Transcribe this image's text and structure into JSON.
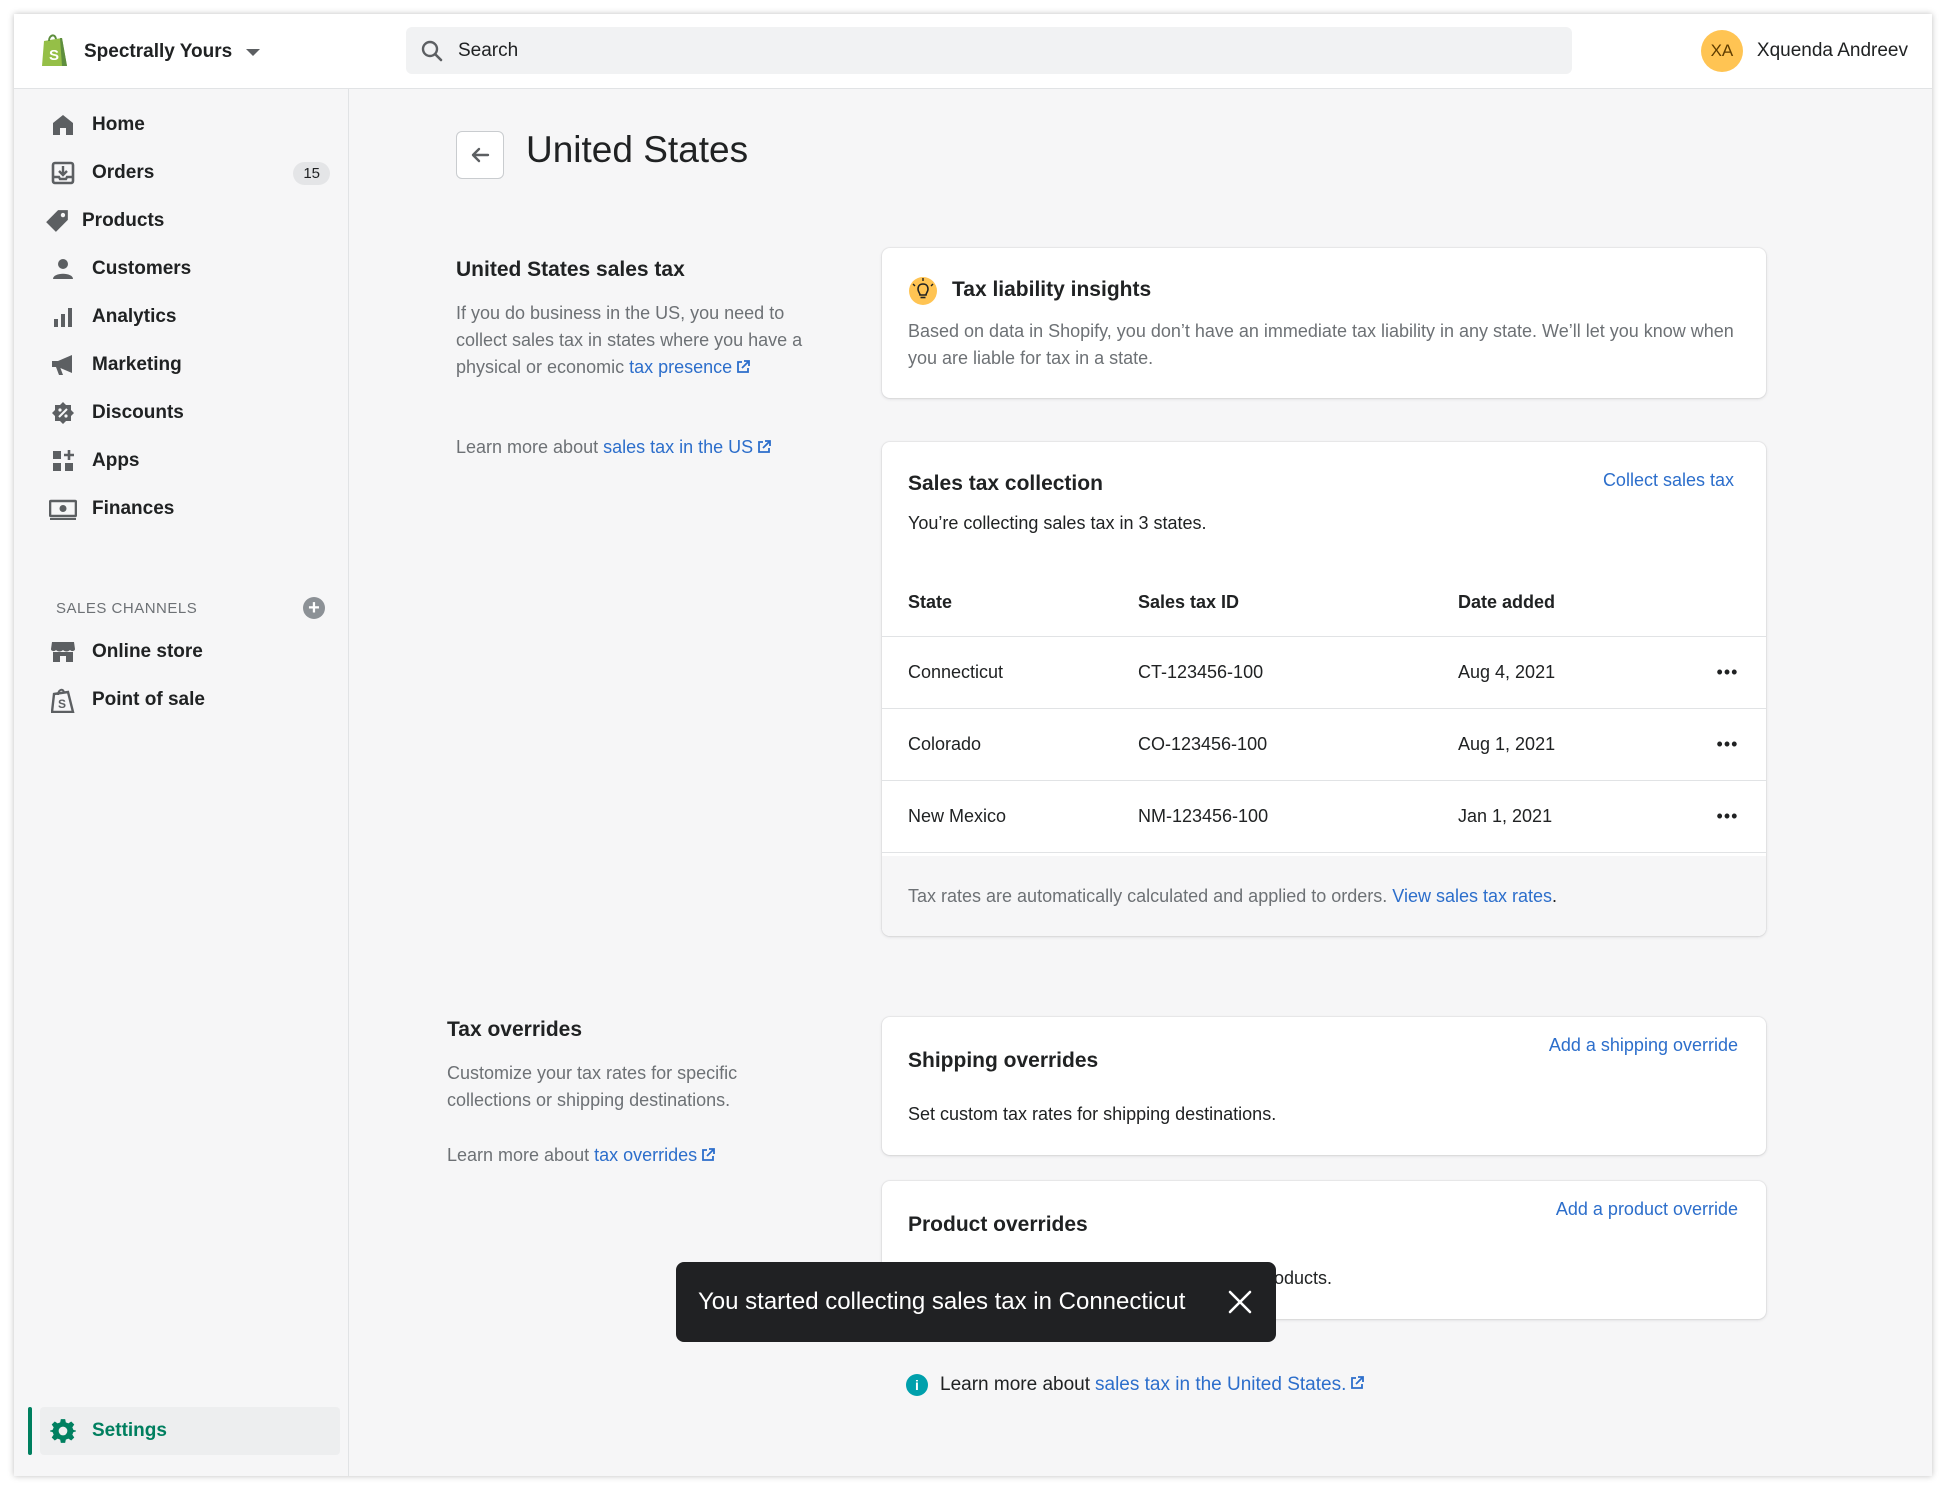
{
  "store": {
    "name": "Spectrally Yours"
  },
  "search": {
    "placeholder": "Search"
  },
  "user": {
    "initials": "XA",
    "name": "Xquenda Andreev"
  },
  "sidebar": {
    "items": [
      {
        "label": "Home"
      },
      {
        "label": "Orders",
        "badge": "15"
      },
      {
        "label": "Products"
      },
      {
        "label": "Customers"
      },
      {
        "label": "Analytics"
      },
      {
        "label": "Marketing"
      },
      {
        "label": "Discounts"
      },
      {
        "label": "Apps"
      },
      {
        "label": "Finances"
      }
    ],
    "channels_heading": "SALES CHANNELS",
    "channels": [
      {
        "label": "Online store"
      },
      {
        "label": "Point of sale"
      }
    ],
    "settings_label": "Settings"
  },
  "page": {
    "title": "United States"
  },
  "us_tax": {
    "heading": "United States sales tax",
    "desc": "If you do business in the US, you need to collect sales tax in states where you have a physical or economic ",
    "desc_link": "tax presence",
    "learn_prefix": "Learn more about ",
    "learn_link": "sales tax in the US"
  },
  "insights": {
    "title": "Tax liability insights",
    "text": "Based on data in Shopify, you don’t have an immediate tax liability in any state. We’ll let you know when you are liable for tax in a state."
  },
  "collection": {
    "title": "Sales tax collection",
    "action": "Collect sales tax",
    "subtitle": "You’re collecting sales tax in 3 states.",
    "columns": [
      "State",
      "Sales tax ID",
      "Date added"
    ],
    "rows": [
      {
        "state": "Connecticut",
        "id": "CT-123456-100",
        "date": "Aug 4, 2021"
      },
      {
        "state": "Colorado",
        "id": "CO-123456-100",
        "date": "Aug 1, 2021"
      },
      {
        "state": "New Mexico",
        "id": "NM-123456-100",
        "date": "Jan 1, 2021"
      }
    ],
    "more_label": "•••",
    "footer_text": "Tax rates are automatically calculated and applied to orders. ",
    "footer_link": "View sales tax rates",
    "footer_end": "."
  },
  "overrides": {
    "heading": "Tax overrides",
    "desc": "Customize your tax rates for specific collections or shipping destinations.",
    "learn_prefix": "Learn more about ",
    "learn_link": "tax overrides"
  },
  "shipping": {
    "title": "Shipping overrides",
    "action": "Add a shipping override",
    "text": "Set custom tax rates for shipping destinations."
  },
  "product": {
    "title": "Product overrides",
    "action": "Add a product override",
    "text_visible": "oducts."
  },
  "toast": {
    "message": "You started collecting sales tax in Connecticut"
  },
  "footer": {
    "prefix": "Learn more about ",
    "link": "sales tax in the United States."
  },
  "colors": {
    "accent": "#008060",
    "link": "#2c6ecb",
    "toast_bg": "#202123"
  }
}
